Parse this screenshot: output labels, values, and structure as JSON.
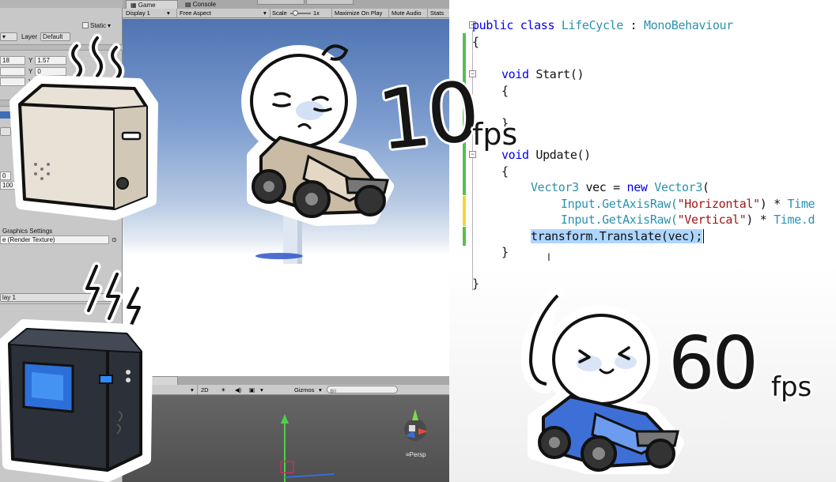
{
  "inspector": {
    "static_label": "Static",
    "layer_label": "Layer",
    "layer_value": "Default",
    "pos_x_value": "18",
    "pos_y_label": "Y",
    "pos_y_value": "1.57",
    "rot_y_label": "Y",
    "rot_y_value": "0",
    "scale_y_label": "Y",
    "scale_y_value": "1",
    "field_a": "0",
    "field_b": "100",
    "field_c": "H",
    "graphics_settings": "Graphics Settings",
    "render_texture": "e (Render Texture)",
    "display_value": "lay 1"
  },
  "game": {
    "tab_game": "Game",
    "tab_console": "Console",
    "display": "Display 1",
    "aspect": "Free Aspect",
    "scale_label": "Scale",
    "scale_value": "1x",
    "maximize": "Maximize On Play",
    "mute": "Mute Audio",
    "stats": "Stats"
  },
  "scene": {
    "tab_scene": "ne",
    "shading": "d",
    "mode_2d": "2D",
    "gizmos": "Gizmos",
    "search_placeholder": "All",
    "persp": "Persp"
  },
  "code": {
    "line1_kw": "public class",
    "line1_type": "LifeCycle",
    "line1_sep": " : ",
    "line1_base": "MonoBehaviour",
    "open_brace": "{",
    "close_brace": "}",
    "start_kw": "void",
    "start_name": " Start()",
    "update_kw": "void",
    "update_name": " Update()",
    "vec_type": "Vector3",
    "vec_mid": " vec = ",
    "vec_new": "new",
    "vec_type2": "Vector3",
    "vec_paren": "(",
    "input1_a": "Input.GetAxisRaw(",
    "input1_str": "\"Horizontal\"",
    "input1_b": ") * ",
    "input1_time": "Time",
    "input2_a": "Input.GetAxisRaw(",
    "input2_str": "\"Vertical\"",
    "input2_b": ") * ",
    "input2_time": "Time.d",
    "translate": "transform.Translate(vec);"
  },
  "overlay": {
    "fps_low_number": "10",
    "fps_low_unit": "fps",
    "fps_high_number": "60",
    "fps_high_unit": "fps"
  },
  "colors": {
    "keyword": "#0000ee",
    "type": "#2b91af",
    "string": "#a31515",
    "selection": "#add6ff",
    "change_green": "#57c04a",
    "change_yellow": "#f5d53c",
    "kart_low": "#c9bba4",
    "kart_high": "#3d6fd6"
  }
}
